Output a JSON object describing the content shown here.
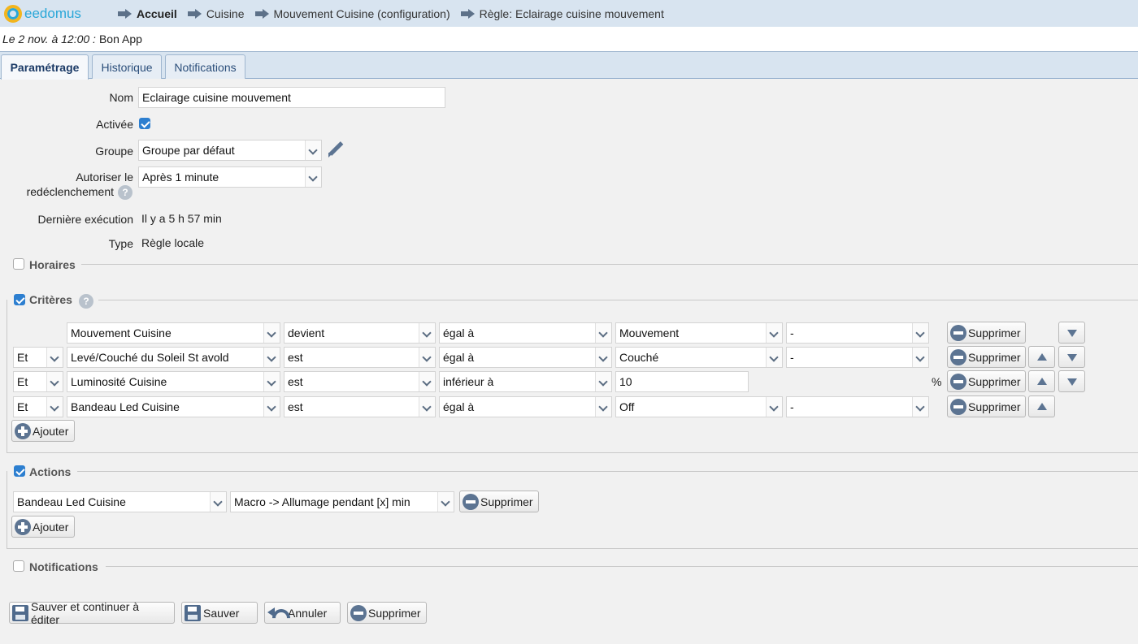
{
  "app": {
    "logo_text": "eedomus"
  },
  "breadcrumb": [
    "Accueil",
    "Cuisine",
    "Mouvement Cuisine (configuration)",
    "Règle: Eclairage cuisine mouvement"
  ],
  "status": {
    "datetime": "Le 2 nov. à 12:00 :",
    "message": "Bon App"
  },
  "tabs": [
    "Paramétrage",
    "Historique",
    "Notifications"
  ],
  "form": {
    "nom_label": "Nom",
    "nom_value": "Eclairage cuisine mouvement",
    "activee_label": "Activée",
    "activee_checked": true,
    "groupe_label": "Groupe",
    "groupe_value": "Groupe par défaut",
    "redecl_label_1": "Autoriser le",
    "redecl_label_2": "redéclenchement",
    "redecl_value": "Après 1 minute",
    "derniere_label": "Dernière exécution",
    "derniere_value": "Il y a 5 h 57 min",
    "type_label": "Type",
    "type_value": "Règle locale",
    "help_glyph": "?"
  },
  "sections": {
    "horaires": {
      "label": "Horaires",
      "checked": false
    },
    "criteres": {
      "label": "Critères",
      "checked": true
    },
    "actions": {
      "label": "Actions",
      "checked": true
    },
    "notifications": {
      "label": "Notifications",
      "checked": false
    }
  },
  "criteria": [
    {
      "conj": "",
      "device": "Mouvement Cuisine",
      "verb": "devient",
      "op": "égal à",
      "value": "Mouvement",
      "extra": "-",
      "unit": ""
    },
    {
      "conj": "Et",
      "device": "Levé/Couché du Soleil St avold",
      "verb": "est",
      "op": "égal à",
      "value": "Couché",
      "extra": "-",
      "unit": ""
    },
    {
      "conj": "Et",
      "device": "Luminosité Cuisine",
      "verb": "est",
      "op": "inférieur à",
      "value": "10",
      "extra": "",
      "unit": "%"
    },
    {
      "conj": "Et",
      "device": "Bandeau Led Cuisine",
      "verb": "est",
      "op": "égal à",
      "value": "Off",
      "extra": "-",
      "unit": ""
    }
  ],
  "actions_rows": [
    {
      "device": "Bandeau Led Cuisine",
      "action": "Macro -> Allumage pendant [x] min"
    }
  ],
  "buttons": {
    "supprimer": "Supprimer",
    "ajouter": "Ajouter",
    "save_continue": "Sauver et continuer à éditer",
    "save": "Sauver",
    "cancel": "Annuler",
    "delete": "Supprimer"
  }
}
